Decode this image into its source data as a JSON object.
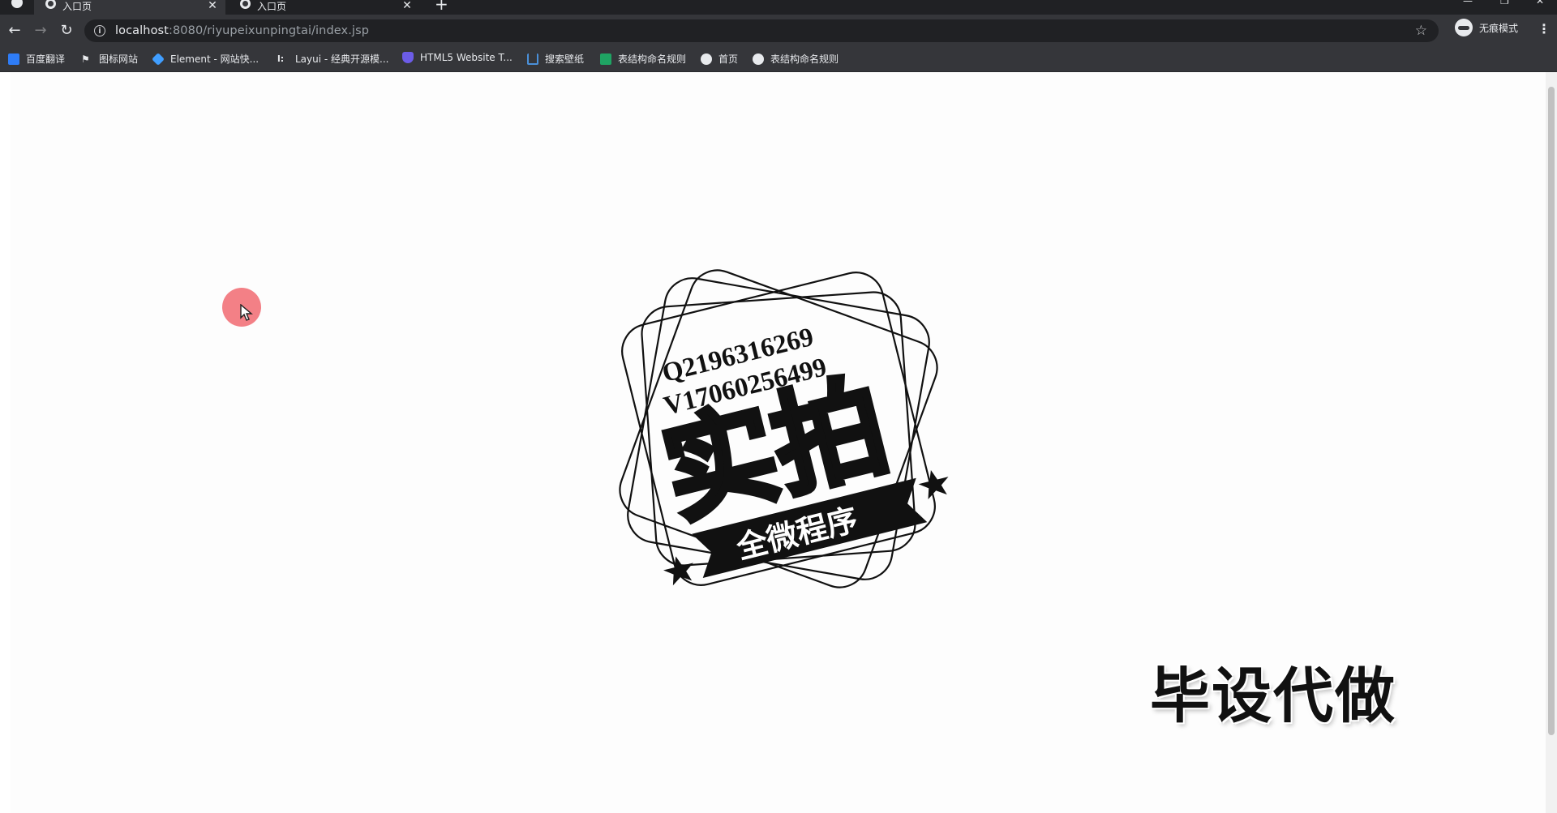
{
  "browser": {
    "tabs": [
      {
        "title": "入口页",
        "active": true
      },
      {
        "title": "入口页",
        "active": false
      }
    ],
    "address": {
      "host": "localhost",
      "path": ":8080/riyupeixunpingtai/index.jsp"
    },
    "profile_label": "无痕模式",
    "bookmarks": [
      {
        "label": "百度翻译",
        "icon": "translate-icon",
        "color": "#2e7cf6"
      },
      {
        "label": "图标网站",
        "icon": "flag-icon",
        "color": "#e8eaed"
      },
      {
        "label": "Element - 网站快...",
        "icon": "element-hexagon-icon",
        "color": "#409eff"
      },
      {
        "label": "Layui - 经典开源模...",
        "icon": "layui-icon",
        "color": "#e8eaed"
      },
      {
        "label": "HTML5 Website T...",
        "icon": "shield-icon",
        "color": "#6c5ce7"
      },
      {
        "label": "搜索壁纸",
        "icon": "wallpaper-icon",
        "color": "#4a90d9"
      },
      {
        "label": "表结构命名规则",
        "icon": "sheet-icon",
        "color": "#1fa463"
      },
      {
        "label": "首页",
        "icon": "globe-icon",
        "color": "#e8eaed"
      },
      {
        "label": "表结构命名规则",
        "icon": "globe-icon",
        "color": "#e8eaed"
      }
    ]
  },
  "stamp": {
    "line1": "Q2196316269",
    "line2": "V17060256499",
    "big": "实拍",
    "ribbon": "全微程序"
  },
  "watermark_bottom": "毕设代做"
}
